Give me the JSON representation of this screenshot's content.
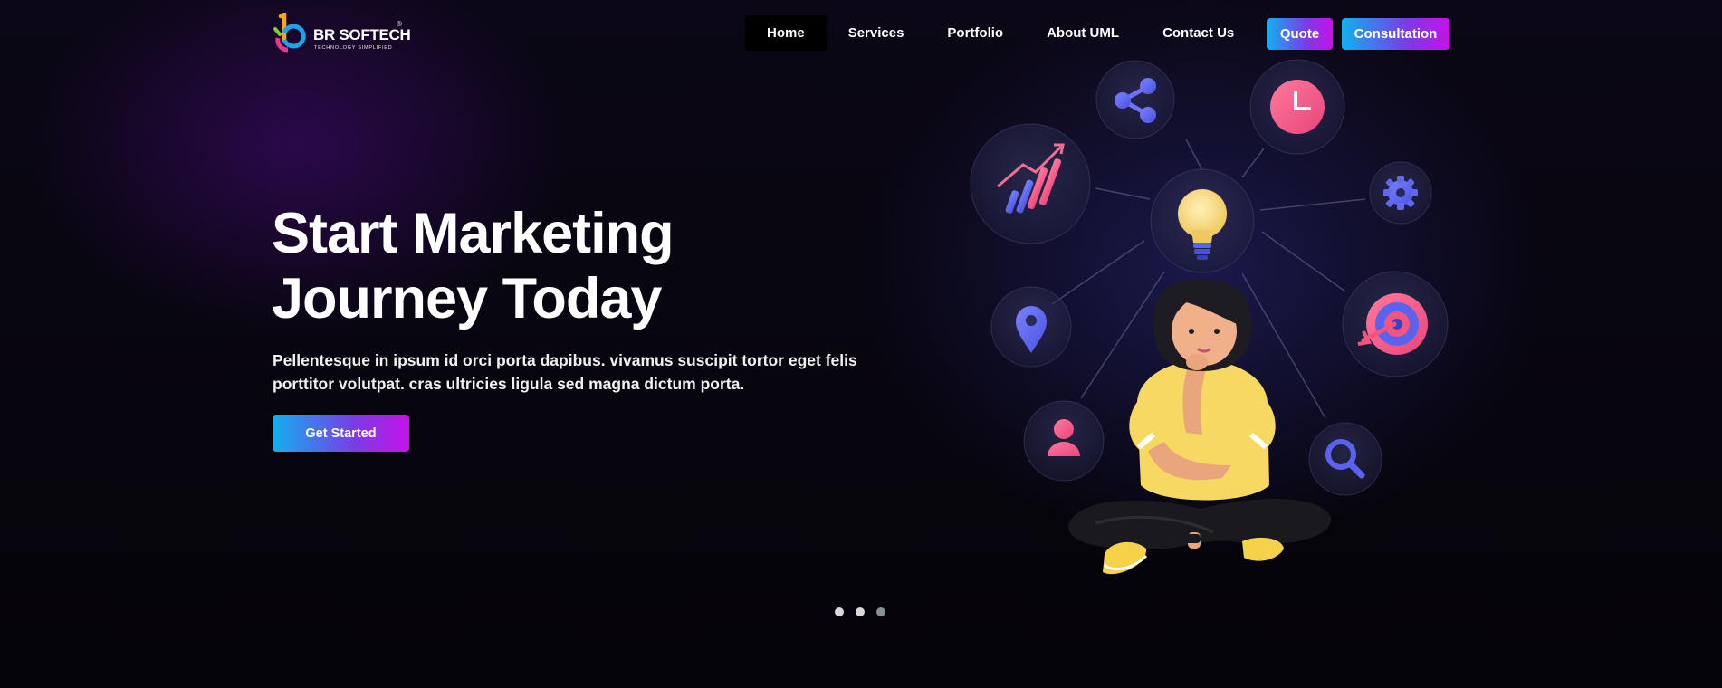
{
  "brand": {
    "name": "BR SOFTECH",
    "tagline": "TECHNOLOGY SIMPLIFIED",
    "registered_mark": "®"
  },
  "nav": {
    "items": [
      {
        "label": "Home",
        "active": true
      },
      {
        "label": "Services",
        "active": false
      },
      {
        "label": "Portfolio",
        "active": false
      },
      {
        "label": "About UML",
        "active": false
      },
      {
        "label": "Contact Us",
        "active": false
      }
    ],
    "quote_label": "Quote",
    "consultation_label": "Consultation"
  },
  "hero": {
    "headline_line1": "Start Marketing",
    "headline_line2": "Journey Today",
    "description_line1": "Pellentesque in ipsum id orci porta dapibus. vivamus suscipit tortor eget felis",
    "description_line2": "porttitor volutpat. cras ultricies ligula sed magna dictum porta.",
    "cta_label": "Get Started"
  },
  "carousel": {
    "slide_count": 3,
    "active_index": 2
  },
  "illustration": {
    "icons": [
      "share-icon",
      "clock-icon",
      "growth-chart-icon",
      "lightbulb-icon",
      "gear-icon",
      "location-pin-icon",
      "target-icon",
      "user-icon",
      "search-icon"
    ]
  },
  "colors": {
    "gradient_start": "#12b0ef",
    "gradient_end": "#c612e8",
    "background": "#07050e",
    "accent_pink": "#f2557e",
    "accent_blue": "#5a63f0"
  }
}
